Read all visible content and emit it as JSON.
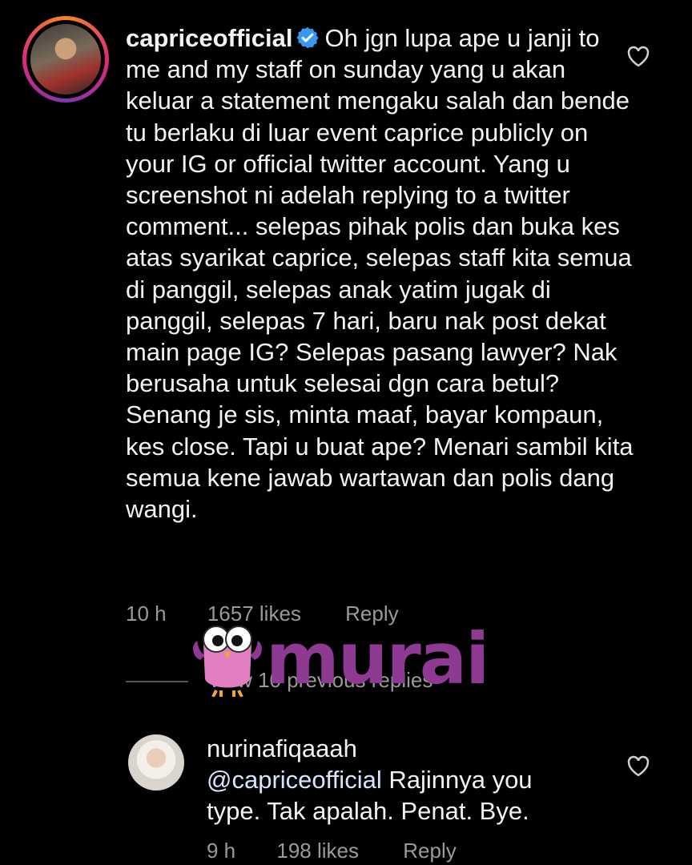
{
  "comment1": {
    "username": "capriceofficial",
    "text": "Oh jgn lupa ape u janji to me and my staff on sunday yang u akan keluar a statement mengaku salah dan bende tu berlaku di luar event caprice publicly on your IG or official twitter account. Yang u screenshot ni adelah replying to a twitter comment... selepas pihak polis dan buka kes atas syarikat caprice, selepas staff kita semua di panggil, selepas anak yatim jugak di panggil, selepas 7 hari, baru nak post dekat main page IG? Selepas pasang lawyer? Nak berusaha untuk selesai dgn cara betul? Senang je sis, minta maaf, bayar kompaun, kes close. Tapi u buat ape? Menari sambil kita semua kene jawab wartawan dan polis dang wangi.",
    "time": "10 h",
    "likes": "1657 likes",
    "reply": "Reply",
    "verified_icon": "verified-badge-icon",
    "heart_icon": "heart-outline-icon"
  },
  "view_replies": {
    "text": "View 10 previous replies"
  },
  "comment2": {
    "username": "nurinafiqaaah",
    "mention": "@capriceofficial",
    "text": " Rajinnya you type. Tak apalah. Penat. Bye.",
    "time": "9 h",
    "likes": "198 likes",
    "reply": "Reply",
    "heart_icon": "heart-outline-icon"
  },
  "watermark": {
    "text": "murai"
  },
  "colors": {
    "background": "#000000",
    "text": "#f2f2f2",
    "meta": "#9a9a9a",
    "verified": "#3897f0",
    "watermark": "#8e3a93"
  }
}
